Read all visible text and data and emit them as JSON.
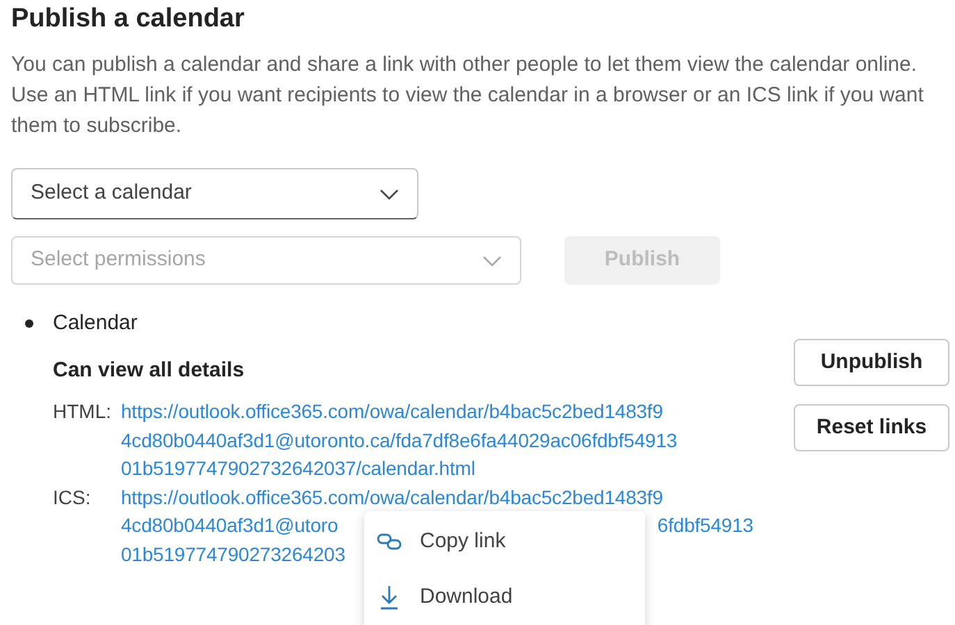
{
  "title": "Publish a calendar",
  "description": "You can publish a calendar and share a link with other people to let them view the calendar online. Use an HTML link if you want recipients to view the calendar in a browser or an ICS link if you want them to subscribe.",
  "calendar_select": {
    "placeholder": "Select a calendar",
    "disabled": false
  },
  "permissions_select": {
    "placeholder": "Select permissions",
    "disabled": true
  },
  "publish_button": {
    "label": "Publish",
    "disabled": true
  },
  "published": [
    {
      "name": "Calendar",
      "permission": "Can view all details",
      "links": [
        {
          "label": "HTML:",
          "lines": [
            [
              "https://outlook.office365.com/owa/calendar/b4bac5c2bed1483f9"
            ],
            [
              "4cd80b0440af3d1@utoronto.ca/fda7df8e6fa44029ac06fdbf54913"
            ],
            [
              "01b5197747902732642037/calendar.html"
            ]
          ]
        },
        {
          "label": "ICS:",
          "lines": [
            [
              "https://outlook.office365.com/owa/calendar/b4bac5c2bed1483f9"
            ],
            [
              "4cd80b0440af3d1@utoro",
              "6fdbf54913"
            ],
            [
              "01b519774790273264203"
            ]
          ]
        }
      ],
      "buttons": [
        "Unpublish",
        "Reset links"
      ]
    }
  ],
  "context_menu": [
    {
      "kind": "copy",
      "label": "Copy link"
    },
    {
      "kind": "download",
      "label": "Download"
    }
  ]
}
